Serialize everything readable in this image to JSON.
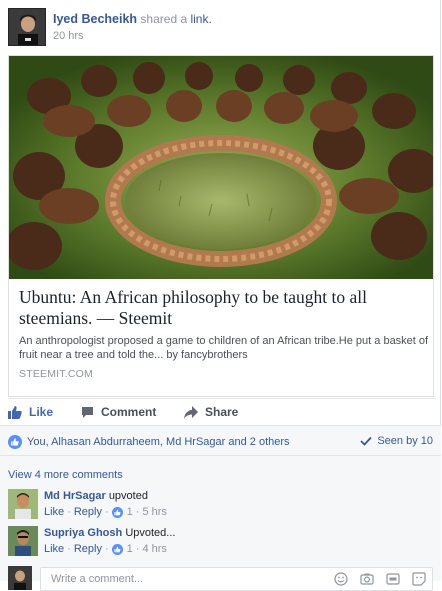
{
  "post": {
    "author": "Iyed Becheikh",
    "action_text": "shared a",
    "action_link": "link.",
    "time": "20 hrs"
  },
  "link_card": {
    "title": "Ubuntu: An African philosophy to be taught to all steemians. — Steemit",
    "description": "An anthropologist proposed a game to children of an African tribe.He put a basket of fruit near a tree and told the... by fancybrothers",
    "domain": "STEEMIT.COM"
  },
  "actions": {
    "like": "Like",
    "comment": "Comment",
    "share": "Share"
  },
  "reactions": {
    "summary": "You, Alhasan Abdurraheem, Md HrSagar and 2 others",
    "seen": "Seen by 10"
  },
  "comments": {
    "view_more": "View 4 more comments",
    "items": [
      {
        "author": "Md HrSagar",
        "text": "upvoted",
        "like": "Like",
        "reply": "Reply",
        "likes": "1",
        "time": "5 hrs"
      },
      {
        "author": "Supriya Ghosh",
        "text": "Upvoted...",
        "like": "Like",
        "reply": "Reply",
        "likes": "1",
        "time": "4 hrs"
      }
    ],
    "write_placeholder": "Write a comment..."
  },
  "colors": {
    "link_blue": "#365899",
    "like_blue": "#4267b2",
    "muted": "#90949c",
    "panel": "#f6f7f9"
  }
}
